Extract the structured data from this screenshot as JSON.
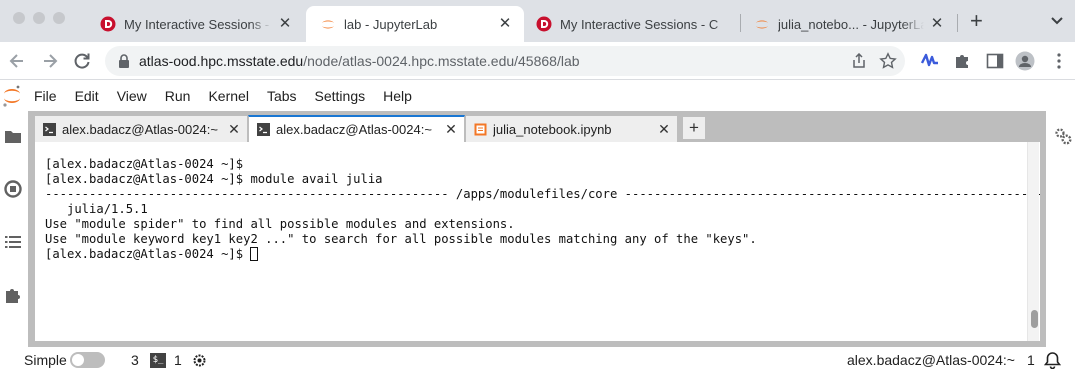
{
  "browser": {
    "tabs": [
      {
        "title": "My Interactive Sessions - M",
        "active": false
      },
      {
        "title": "lab - JupyterLab",
        "active": true
      },
      {
        "title": "My Interactive Sessions - C",
        "active": false
      },
      {
        "title": "julia_notebo... - JupyterLab",
        "active": false
      }
    ],
    "url_host": "atlas-ood.hpc.msstate.edu",
    "url_path": "/node/atlas-0024.hpc.msstate.edu/45868/lab",
    "new_tab_glyph": "+",
    "close_glyph": "✕"
  },
  "menu": {
    "items": [
      "File",
      "Edit",
      "View",
      "Run",
      "Kernel",
      "Tabs",
      "Settings",
      "Help"
    ]
  },
  "doc_tabs": [
    {
      "label": "alex.badacz@Atlas-0024:~",
      "kind": "terminal",
      "active": false
    },
    {
      "label": "alex.badacz@Atlas-0024:~",
      "kind": "terminal",
      "active": true
    },
    {
      "label": "julia_notebook.ipynb",
      "kind": "notebook",
      "active": false
    }
  ],
  "add_tab_glyph": "+",
  "terminal": {
    "lines": [
      "[alex.badacz@Atlas-0024 ~]$",
      "[alex.badacz@Atlas-0024 ~]$ module avail julia",
      "",
      "------------------------------------------------------- /apps/modulefiles/core ----------------------------------------------------------",
      "   julia/1.5.1",
      "",
      "Use \"module spider\" to find all possible modules and extensions.",
      "Use \"module keyword key1 key2 ...\" to search for all possible modules matching any of the \"keys\".",
      "",
      "",
      "[alex.badacz@Atlas-0024 ~]$ "
    ]
  },
  "status": {
    "mode_label": "Simple",
    "terminals_count": "3",
    "kernels_count": "1",
    "terminal_badge": "$_",
    "active_doc": "alex.badacz@Atlas-0024:~",
    "line_col": "1"
  },
  "colors": {
    "accent": "#1976d2",
    "jupyter_orange": "#f37726",
    "browser_chrome": "#dee1e6"
  }
}
